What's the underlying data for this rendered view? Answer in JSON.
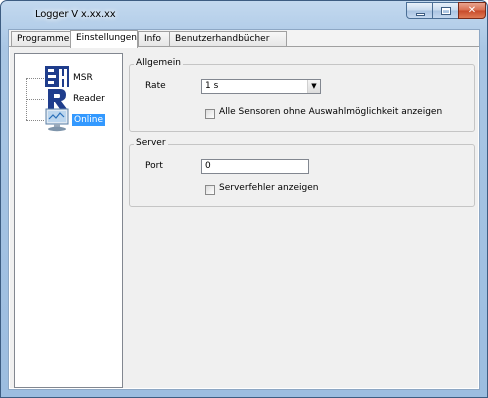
{
  "window": {
    "title": "Logger V x.xx.xx"
  },
  "tabs": [
    {
      "label": "Programme",
      "active": false
    },
    {
      "label": "Einstellungen",
      "active": true
    },
    {
      "label": "Info",
      "active": false
    },
    {
      "label": "Benutzerhandbücher",
      "active": false
    }
  ],
  "nav": {
    "items": [
      {
        "label": "MSR",
        "icon": "msr-icon"
      },
      {
        "label": "Reader",
        "icon": "reader-icon"
      },
      {
        "label": "Online",
        "icon": "online-icon",
        "selected": true
      }
    ]
  },
  "general": {
    "title": "Allgemein",
    "rate_label": "Rate",
    "rate_value": "1 s",
    "show_all_label": "Alle Sensoren ohne Auswahlmöglichkeit anzeigen",
    "show_all_checked": false
  },
  "server": {
    "title": "Server",
    "port_label": "Port",
    "port_value": "0",
    "errors_label": "Serverfehler anzeigen",
    "errors_checked": false
  },
  "colors": {
    "selection": "#3399ff",
    "titlebar": "#a9c6e4",
    "close_button": "#c74a2a"
  }
}
